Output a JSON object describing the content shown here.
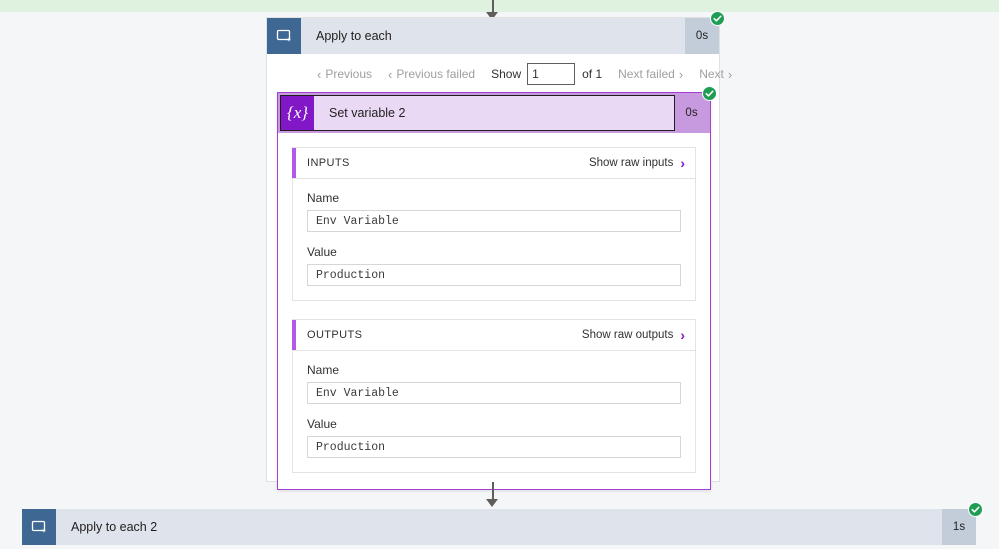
{
  "canvas": {
    "accent_purple": "#8117c7",
    "loop_blue": "#3f6794",
    "success_green": "#1f9d55"
  },
  "loop_action": {
    "title": "Apply to each",
    "duration": "0s",
    "icon": "loop-icon",
    "status": "succeeded",
    "status_icon": "check-icon",
    "pager": {
      "previous_label": "Previous",
      "previous_failed_label": "Previous failed",
      "show_label": "Show",
      "show_value": "1",
      "of_label": "of 1",
      "next_failed_label": "Next failed",
      "next_label": "Next",
      "chevron_left": "‹",
      "chevron_right": "›"
    }
  },
  "set_variable_action": {
    "title": "Set variable 2",
    "duration": "0s",
    "icon": "variable-icon",
    "icon_glyph": "{x}",
    "status": "succeeded",
    "status_icon": "check-icon",
    "inputs": {
      "heading": "INPUTS",
      "raw_link": "Show raw inputs",
      "fields": [
        {
          "label": "Name",
          "value": "Env Variable"
        },
        {
          "label": "Value",
          "value": "Production"
        }
      ]
    },
    "outputs": {
      "heading": "OUTPUTS",
      "raw_link": "Show raw outputs",
      "fields": [
        {
          "label": "Name",
          "value": "Env Variable"
        },
        {
          "label": "Value",
          "value": "Production"
        }
      ]
    }
  },
  "loop_action_2": {
    "title": "Apply to each 2",
    "duration": "1s",
    "icon": "loop-icon",
    "status": "succeeded",
    "status_icon": "check-icon"
  }
}
